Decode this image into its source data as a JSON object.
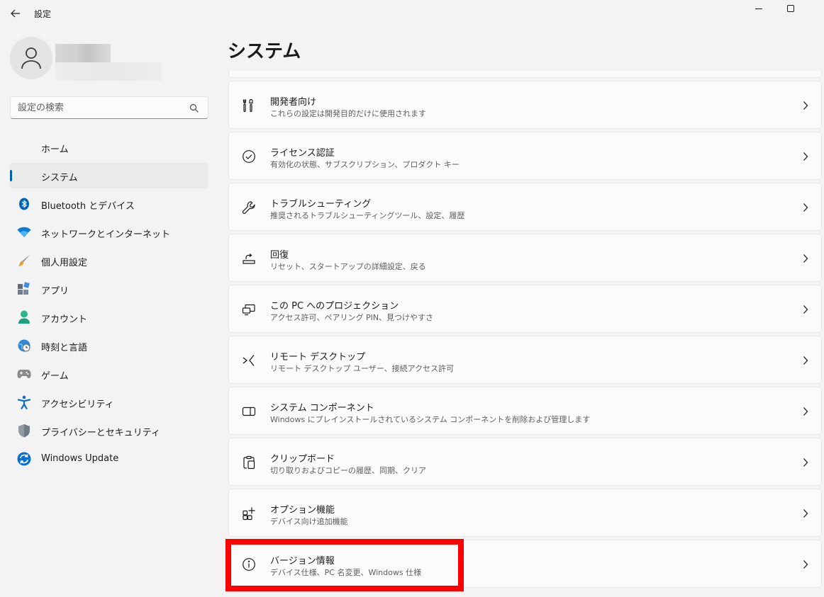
{
  "app": {
    "title": "設定"
  },
  "search": {
    "placeholder": "設定の検索"
  },
  "sidebar": {
    "items": [
      {
        "label": "ホーム",
        "icon": "home-icon"
      },
      {
        "label": "システム",
        "icon": "system-icon",
        "active": true
      },
      {
        "label": "Bluetooth とデバイス",
        "icon": "bluetooth-icon"
      },
      {
        "label": "ネットワークとインターネット",
        "icon": "wifi-icon"
      },
      {
        "label": "個人用設定",
        "icon": "brush-icon"
      },
      {
        "label": "アプリ",
        "icon": "apps-icon"
      },
      {
        "label": "アカウント",
        "icon": "account-icon"
      },
      {
        "label": "時刻と言語",
        "icon": "clock-globe-icon"
      },
      {
        "label": "ゲーム",
        "icon": "gamepad-icon"
      },
      {
        "label": "アクセシビリティ",
        "icon": "accessibility-icon"
      },
      {
        "label": "プライバシーとセキュリティ",
        "icon": "shield-icon"
      },
      {
        "label": "Windows Update",
        "icon": "update-icon"
      }
    ]
  },
  "main": {
    "title": "システム",
    "cards": [
      {
        "title": "開発者向け",
        "subtitle": "これらの設定は開発目的だけに使用されます",
        "icon": "developer-tools-icon"
      },
      {
        "title": "ライセンス認証",
        "subtitle": "有効化の状態、サブスクリプション、プロダクト キー",
        "icon": "check-circle-icon"
      },
      {
        "title": "トラブルシューティング",
        "subtitle": "推奨されるトラブルシューティングツール、設定、履歴",
        "icon": "wrench-icon"
      },
      {
        "title": "回復",
        "subtitle": "リセット、スタートアップの詳細設定、戻る",
        "icon": "recovery-icon"
      },
      {
        "title": "この PC へのプロジェクション",
        "subtitle": "アクセス許可、ペアリング PIN、見つけやすさ",
        "icon": "projection-icon"
      },
      {
        "title": "リモート デスクトップ",
        "subtitle": "リモート デスクトップ ユーザー、接続アクセス許可",
        "icon": "remote-desktop-icon"
      },
      {
        "title": "システム コンポーネント",
        "subtitle": "Windows にプレインストールされているシステム コンポーネントを削除および管理します",
        "icon": "system-components-icon"
      },
      {
        "title": "クリップボード",
        "subtitle": "切り取りおよびコピーの履歴、同期、クリア",
        "icon": "clipboard-icon"
      },
      {
        "title": "オプション機能",
        "subtitle": "デバイス向け追加機能",
        "icon": "optional-features-icon"
      },
      {
        "title": "バージョン情報",
        "subtitle": "デバイス仕様、PC 名変更、Windows 仕様",
        "icon": "info-icon"
      }
    ]
  },
  "colors": {
    "accent": "#005fb8",
    "highlight": "#ff0000"
  }
}
